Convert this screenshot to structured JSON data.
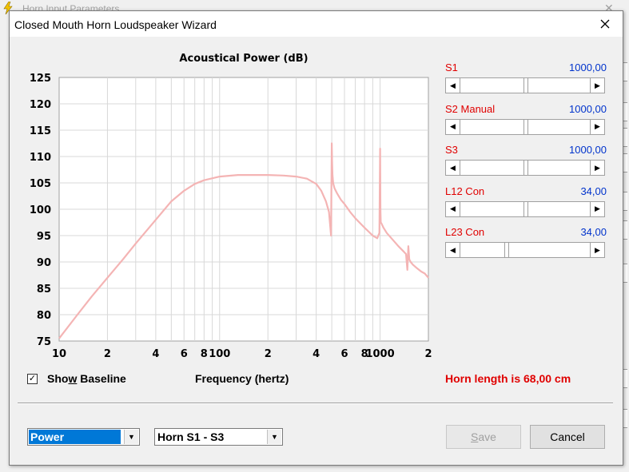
{
  "background_window": {
    "title": "Horn  Input Parameters"
  },
  "dialog": {
    "title": "Closed Mouth Horn Loudspeaker Wizard"
  },
  "chart_data": {
    "type": "line",
    "title": "Acoustical Power (dB)",
    "xlabel": "Frequency (hertz)",
    "ylabel": "",
    "x_scale": "log",
    "xlim": [
      10,
      2000
    ],
    "ylim": [
      75,
      125
    ],
    "y_ticks": [
      "125",
      "120",
      "115",
      "110",
      "105",
      "100",
      "95",
      "90",
      "85",
      "80",
      "75"
    ],
    "x_ticks": [
      {
        "value": 10,
        "label": "10"
      },
      {
        "value": 20,
        "label": "2"
      },
      {
        "value": 40,
        "label": "4"
      },
      {
        "value": 60,
        "label": "6"
      },
      {
        "value": 80,
        "label": "8"
      },
      {
        "value": 100,
        "label": "100"
      },
      {
        "value": 200,
        "label": "2"
      },
      {
        "value": 400,
        "label": "4"
      },
      {
        "value": 600,
        "label": "6"
      },
      {
        "value": 800,
        "label": "8"
      },
      {
        "value": 1000,
        "label": "1000"
      },
      {
        "value": 2000,
        "label": "2"
      }
    ],
    "grid": true,
    "line_color": "#f4b4b4",
    "series": [
      {
        "x": [
          10,
          13,
          16,
          20,
          25,
          30,
          40,
          50,
          60,
          70,
          80,
          100,
          130,
          160,
          200,
          250,
          300,
          350,
          400,
          430,
          460,
          480,
          495,
          500,
          502,
          505,
          510,
          520,
          540,
          570,
          600,
          650,
          700,
          800,
          900,
          960,
          990,
          1000,
          1005,
          1010,
          1020,
          1050,
          1100,
          1200,
          1300,
          1400,
          1450,
          1480,
          1500,
          1520,
          1550,
          1600,
          1700,
          1800,
          1900,
          2000
        ],
        "y": [
          75.5,
          80,
          83.5,
          87,
          90.5,
          93.5,
          98,
          101.5,
          103.5,
          104.8,
          105.5,
          106.2,
          106.5,
          106.5,
          106.5,
          106.4,
          106.2,
          105.8,
          104.8,
          103.5,
          101.5,
          99.5,
          95,
          112.5,
          109,
          106.5,
          105,
          104,
          103,
          101.8,
          101,
          99.5,
          98.3,
          96.5,
          95,
          94.5,
          95.5,
          111.5,
          100,
          97.5,
          97.3,
          96.5,
          95.5,
          94.2,
          93,
          92,
          91.5,
          88.5,
          93,
          90.5,
          90,
          89.5,
          88.8,
          88.2,
          87.8,
          87
        ]
      }
    ]
  },
  "sliders": [
    {
      "label": "S1",
      "value": "1000,00",
      "position": 0.5
    },
    {
      "label": "S2  Manual",
      "value": "1000,00",
      "position": 0.5
    },
    {
      "label": "S3",
      "value": "1000,00",
      "position": 0.5
    },
    {
      "label": "L12  Con",
      "value": "34,00",
      "position": 0.5
    },
    {
      "label": "L23  Con",
      "value": "34,00",
      "position": 0.35
    }
  ],
  "baseline": {
    "label_before": "Sho",
    "label_underline": "w",
    "label_after": " Baseline",
    "checked": true,
    "check_glyph": "✓"
  },
  "frequency_label": "Frequency (hertz)",
  "horn_length_text": "Horn length is 68,00 cm",
  "combo_power": {
    "value": "Power"
  },
  "combo_horn": {
    "value": "Horn S1 - S3"
  },
  "buttons": {
    "save_underline": "S",
    "save_rest": "ave",
    "cancel_label": "Cancel"
  },
  "colors": {
    "label_red": "#e00000",
    "value_blue": "#0033cc",
    "selection_blue": "#0078d7"
  }
}
